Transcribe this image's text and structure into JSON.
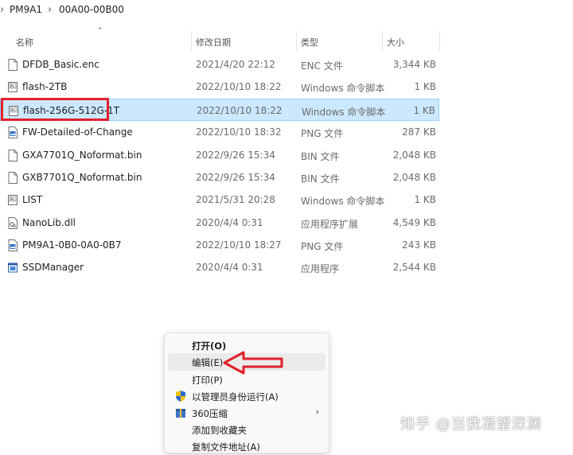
{
  "breadcrumb": {
    "items": [
      "PM9A1",
      "00A00-00B00"
    ],
    "separator": "›"
  },
  "columns": {
    "name": "名称",
    "date": "修改日期",
    "type": "类型",
    "size": "大小"
  },
  "files": [
    {
      "name": "DFDB_Basic.enc",
      "date": "2021/4/20 22:12",
      "type": "ENC 文件",
      "size": "3,344 KB",
      "icon": "blank-file-icon"
    },
    {
      "name": "flash-2TB",
      "date": "2022/10/10 18:22",
      "type": "Windows 命令脚本",
      "size": "1 KB",
      "icon": "script-file-icon"
    },
    {
      "name": "flash-256G-512G-1T",
      "date": "2022/10/10 18:22",
      "type": "Windows 命令脚本",
      "size": "1 KB",
      "icon": "script-file-icon",
      "selected": true
    },
    {
      "name": "FW-Detailed-of-Change",
      "date": "2022/10/10 18:32",
      "type": "PNG 文件",
      "size": "287 KB",
      "icon": "image-file-icon"
    },
    {
      "name": "GXA7701Q_Noformat.bin",
      "date": "2022/9/26 15:34",
      "type": "BIN 文件",
      "size": "2,048 KB",
      "icon": "blank-file-icon"
    },
    {
      "name": "GXB7701Q_Noformat.bin",
      "date": "2022/9/26 15:34",
      "type": "BIN 文件",
      "size": "2,048 KB",
      "icon": "blank-file-icon"
    },
    {
      "name": "LIST",
      "date": "2021/5/31 20:28",
      "type": "Windows 命令脚本",
      "size": "1 KB",
      "icon": "script-file-icon"
    },
    {
      "name": "NanoLib.dll",
      "date": "2020/4/4 0:31",
      "type": "应用程序扩展",
      "size": "4,549 KB",
      "icon": "dll-file-icon"
    },
    {
      "name": "PM9A1-0B0-0A0-0B7",
      "date": "2022/10/10 18:27",
      "type": "PNG 文件",
      "size": "243 KB",
      "icon": "image-file-icon"
    },
    {
      "name": "SSDManager",
      "date": "2020/4/4 0:31",
      "type": "应用程序",
      "size": "2,544 KB",
      "icon": "app-file-icon"
    }
  ],
  "context_menu": {
    "items": [
      {
        "label": "打开(O)",
        "bold": true,
        "icon": ""
      },
      {
        "label": "编辑(E)",
        "hover": true,
        "icon": ""
      },
      {
        "label": "打印(P)",
        "icon": ""
      },
      {
        "label": "以管理员身份运行(A)",
        "icon": "shield-icon"
      },
      {
        "label": "360压缩",
        "icon": "archive-icon",
        "submenu": true
      },
      {
        "label": "添加到收藏夹",
        "icon": ""
      },
      {
        "label": "复制文件地址(A)",
        "icon": ""
      }
    ]
  },
  "watermark": "知乎 @当我凝望深渊",
  "colors": {
    "selected_bg": "#cce8ff",
    "highlight_red": "#e0202a",
    "menu_bg": "#f9f9f9"
  }
}
